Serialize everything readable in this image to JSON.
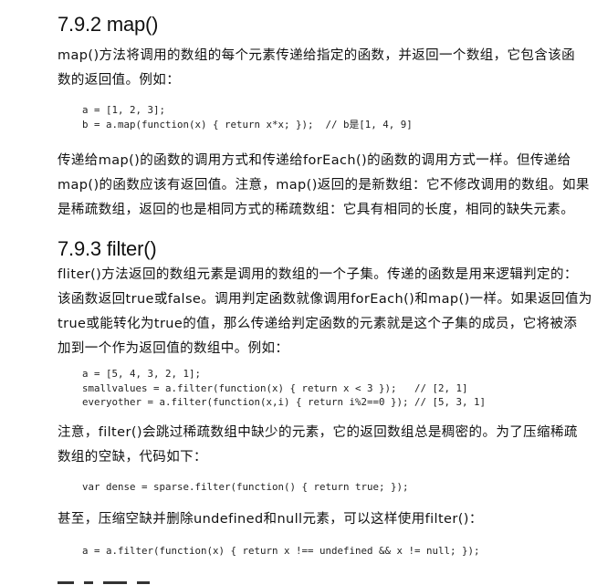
{
  "section_map": {
    "heading": "7.9.2 map()",
    "intro_lines": [
      "map()方法将调用的数组的每个元素传递给指定的函数，并返回一个数组，它包含该函",
      "数的返回值。例如："
    ],
    "code": [
      "a = [1, 2, 3];",
      "b = a.map(function(x) { return x*x; });  // b是[1, 4, 9]"
    ],
    "body_lines": [
      "传递给map()的函数的调用方式和传递给forEach()的函数的调用方式一样。但传递给",
      "map()的函数应该有返回值。注意，map()返回的是新数组：它不修改调用的数组。如果",
      "是稀疏数组，返回的也是相同方式的稀疏数组：它具有相同的长度，相同的缺失元素。"
    ]
  },
  "section_filter": {
    "heading": "7.9.3 filter()",
    "intro_lines": [
      "fliter()方法返回的数组元素是调用的数组的一个子集。传递的函数是用来逻辑判定的：",
      "该函数返回true或false。调用判定函数就像调用forEach()和map()一样。如果返回值为",
      "true或能转化为true的值，那么传递给判定函数的元素就是这个子集的成员，它将被添",
      "加到一个作为返回值的数组中。例如："
    ],
    "code": [
      "a = [5, 4, 3, 2, 1];",
      "smallvalues = a.filter(function(x) { return x < 3 });   // [2, 1]",
      "everyother = a.filter(function(x,i) { return i%2==0 }); // [5, 3, 1]"
    ],
    "note_lines": [
      "注意，filter()会跳过稀疏数组中缺少的元素，它的返回数组总是稠密的。为了压缩稀疏",
      "数组的空缺，代码如下："
    ],
    "code2": [
      "var dense = sparse.filter(function() { return true; });"
    ],
    "note2_lines": [
      "甚至，压缩空缺并删除undefined和null元素，可以这样使用filter()："
    ],
    "code3": [
      "a = a.filter(function(x) { return x !== undefined && x != null; });"
    ]
  }
}
